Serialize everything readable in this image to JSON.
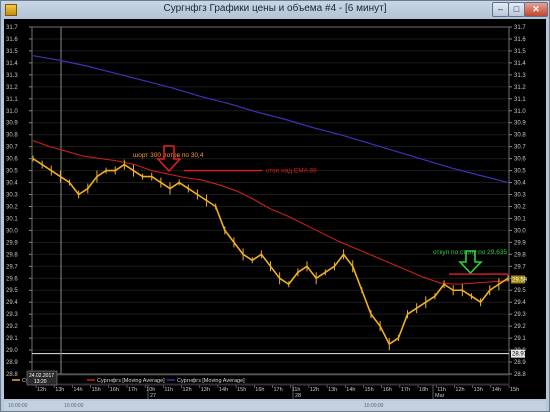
{
  "window": {
    "title": "Сургнфгз Графики цены и объема #4 - [6 минут]",
    "buttons": {
      "minimize": "–",
      "maximize": "□",
      "close": "✕"
    }
  },
  "status_bar": {
    "left": "10:00:00",
    "mid": "10:00:00",
    "right": "10:00:00"
  },
  "chart": {
    "y_axis_ticks": [
      "31.7",
      "31.6",
      "31.5",
      "31.4",
      "31.3",
      "31.2",
      "31.1",
      "31.0",
      "30.9",
      "30.8",
      "30.7",
      "30.6",
      "30.5",
      "30.4",
      "30.3",
      "30.2",
      "30.1",
      "30.0",
      "29.9",
      "29.8",
      "29.7",
      "29.6",
      "29.5",
      "29.4",
      "29.3",
      "29.2",
      "29.1",
      "29.0",
      "28.9",
      "28.8"
    ],
    "price_tag_current": "29.59",
    "price_tag_low": "28.97",
    "cursor_date": "24.02.2017",
    "cursor_time": "13:20",
    "time_labels": [
      "12h",
      "13h",
      "14h",
      "15h",
      "16h",
      "17h",
      "10h",
      "11h",
      "12h",
      "13h",
      "14h",
      "15h",
      "16h",
      "17h",
      "11h",
      "12h",
      "13h",
      "14h",
      "15h",
      "16h",
      "17h",
      "18h",
      "11h",
      "12h",
      "13h",
      "14h",
      "15h"
    ],
    "date_labels": [
      "27",
      "28",
      "Mar"
    ],
    "legend": [
      "Сургнфгз",
      "Сургнфгз [Moving Average]",
      "Сургнфгз [Moving Average]"
    ],
    "annotations": {
      "short_text": "шорт 300 лотов по 30,4",
      "stop_text": "стоп над EMA 89",
      "buy_text": "откуп по стопу по 29,635"
    },
    "colors": {
      "background": "#000000",
      "price": "#f0b020",
      "ma_fast": "#c8201c",
      "ma_slow": "#4030b8",
      "short_annotation": "#ff9a2e",
      "stop_annotation": "#e02020",
      "buy_annotation": "#30d040",
      "grid": "#1c1c1c"
    }
  },
  "chart_data": {
    "type": "line",
    "y_range": [
      28.8,
      31.7
    ],
    "series": [
      {
        "name": "Сургнфгз",
        "values": [
          30.6,
          30.55,
          30.5,
          30.45,
          30.4,
          30.3,
          30.35,
          30.45,
          30.5,
          30.5,
          30.55,
          30.5,
          30.45,
          30.45,
          30.4,
          30.35,
          30.4,
          30.35,
          30.3,
          30.25,
          30.2,
          30.0,
          29.9,
          29.8,
          29.75,
          29.8,
          29.7,
          29.6,
          29.55,
          29.65,
          29.7,
          29.6,
          29.65,
          29.7,
          29.8,
          29.7,
          29.5,
          29.3,
          29.2,
          29.05,
          29.1,
          29.3,
          29.35,
          29.4,
          29.45,
          29.55,
          29.5,
          29.5,
          29.45,
          29.4,
          29.5,
          29.55,
          29.6
        ]
      },
      {
        "name": "Сургнфгз [Moving Average]",
        "values": [
          30.75,
          30.7,
          30.66,
          30.62,
          30.6,
          30.58,
          30.55,
          30.5,
          30.47,
          30.44,
          30.42,
          30.38,
          30.33,
          30.26,
          30.18,
          30.12,
          30.05,
          29.98,
          29.91,
          29.85,
          29.79,
          29.73,
          29.67,
          29.61,
          29.56,
          29.55,
          29.56,
          29.57,
          29.58
        ]
      },
      {
        "name": "Сургнфгз [Moving Average]",
        "values": [
          31.46,
          31.42,
          31.37,
          31.31,
          31.25,
          31.19,
          31.12,
          31.06,
          30.99,
          30.93,
          30.86,
          30.8,
          30.73,
          30.66,
          30.59,
          30.52,
          30.46,
          30.4
        ]
      }
    ]
  }
}
